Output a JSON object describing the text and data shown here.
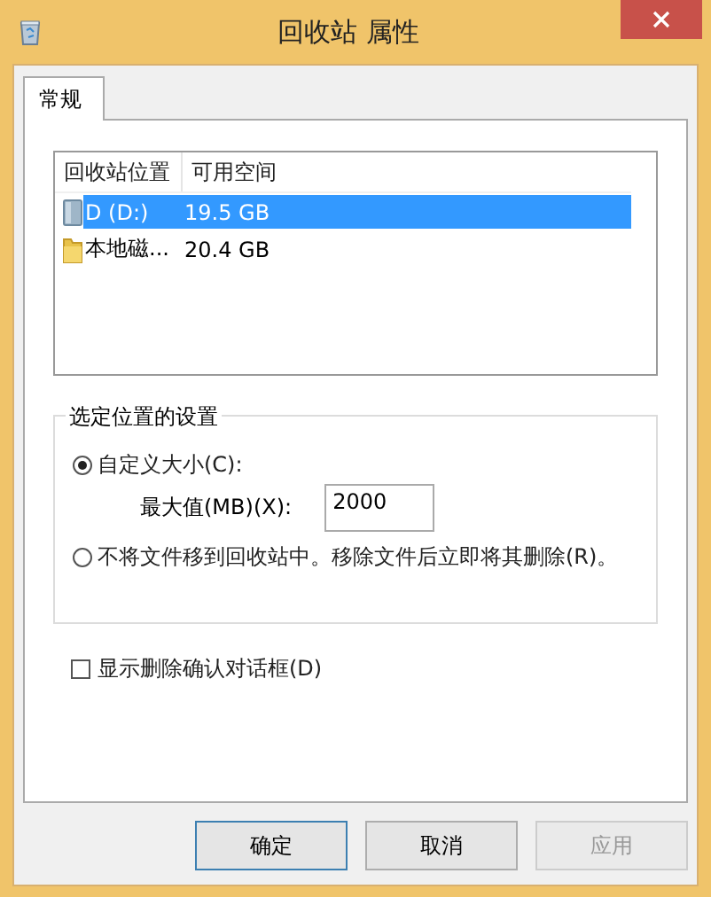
{
  "window": {
    "title": "回收站 属性"
  },
  "tabs": [
    {
      "label": "常规",
      "selected": true
    }
  ],
  "locations": {
    "columns": [
      "回收站位置",
      "可用空间"
    ],
    "rows": [
      {
        "kind": "drive",
        "name": "D (D:)",
        "free": "19.5 GB",
        "selected": true
      },
      {
        "kind": "folder",
        "name": "本地磁...",
        "free": "20.4 GB",
        "selected": false
      }
    ]
  },
  "settings": {
    "legend": "选定位置的设置",
    "options": [
      {
        "label": "自定义大小(C):",
        "selected": true
      },
      {
        "label": "不将文件移到回收站中。移除文件后立即将其删除(R)。",
        "selected": false
      }
    ],
    "max_size": {
      "label": "最大值(MB)(X):",
      "value": "2000"
    }
  },
  "confirm": {
    "label": "显示删除确认对话框(D)",
    "checked": false
  },
  "buttons": [
    {
      "label": "确定",
      "default": true,
      "disabled": false
    },
    {
      "label": "取消",
      "default": false,
      "disabled": false
    },
    {
      "label": "应用",
      "default": false,
      "disabled": true
    }
  ]
}
